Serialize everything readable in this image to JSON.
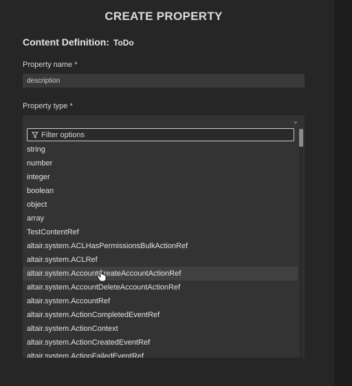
{
  "dialog": {
    "title": "CREATE PROPERTY",
    "content_definition_label": "Content Definition:",
    "content_definition_value": "ToDo"
  },
  "property_name": {
    "label": "Property name *",
    "value": "description"
  },
  "property_type": {
    "label": "Property type *",
    "chevron_icon": "chevron-down-icon",
    "filter_placeholder": "Filter options",
    "filter_icon": "filter-icon",
    "options": [
      "string",
      "number",
      "integer",
      "boolean",
      "object",
      "array",
      "TestContentRef",
      "altair.system.ACLHasPermissionsBulkActionRef",
      "altair.system.ACLRef",
      "altair.system.AccountCreateAccountActionRef",
      "altair.system.AccountDeleteAccountActionRef",
      "altair.system.AccountRef",
      "altair.system.ActionCompletedEventRef",
      "altair.system.ActionContext",
      "altair.system.ActionCreatedEventRef",
      "altair.system.ActionFailedEventRef"
    ],
    "hovered_option": "altair.system.AccountCreateAccountActionRef"
  },
  "colors": {
    "background": "#262626",
    "input_background": "#3a3a3a",
    "dropdown_background": "#333333",
    "hover_background": "#414141",
    "text": "#e6e6e6"
  }
}
